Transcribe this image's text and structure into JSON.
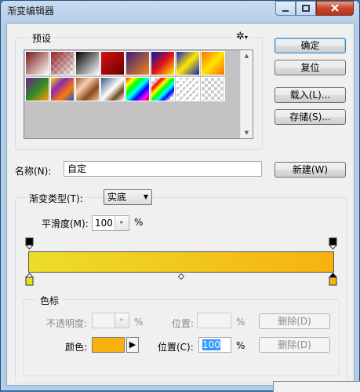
{
  "window": {
    "title": "渐变编辑器"
  },
  "buttons": {
    "ok": "确定",
    "reset": "复位",
    "load": "载入(L)...",
    "save": "存储(S)...",
    "new": "新建(W)",
    "delete_opacity": "删除(D)",
    "delete_color": "删除(D)"
  },
  "presets": {
    "legend": "预设",
    "gear": "✲"
  },
  "name": {
    "label": "名称(N):",
    "value": "自定"
  },
  "gradient": {
    "type_label": "渐变类型(T):",
    "type_value": "实底",
    "smoothness_label": "平滑度(M):",
    "smoothness_value": "100",
    "percent": "%",
    "start_color": "#ecde28",
    "end_color": "#f7b20e"
  },
  "stops": {
    "legend": "色标",
    "opacity_label": "不透明度:",
    "opacity_value": "",
    "opacity_unit": "%",
    "opacity_location_label": "位置:",
    "opacity_location_value": "",
    "opacity_location_unit": "%",
    "color_label": "颜色:",
    "color_value": "#f7b20e",
    "location_label": "位置(C):",
    "location_value": "100",
    "location_unit": "%"
  },
  "swatches": [
    {
      "name": "foreground-to-background"
    },
    {
      "name": "foreground-to-transparent"
    },
    {
      "name": "black-white"
    },
    {
      "name": "red-fade"
    },
    {
      "name": "violet-orange"
    },
    {
      "name": "blue-red-yellow"
    },
    {
      "name": "blue-yellow-blue"
    },
    {
      "name": "orange-yellow-orange"
    },
    {
      "name": "violet-green-orange"
    },
    {
      "name": "yellow-violet-orange-blue"
    },
    {
      "name": "copper"
    },
    {
      "name": "chrome"
    },
    {
      "name": "spectrum"
    },
    {
      "name": "transparent-rainbow"
    },
    {
      "name": "transparent-stripes"
    },
    {
      "name": "transparent-checker"
    }
  ]
}
